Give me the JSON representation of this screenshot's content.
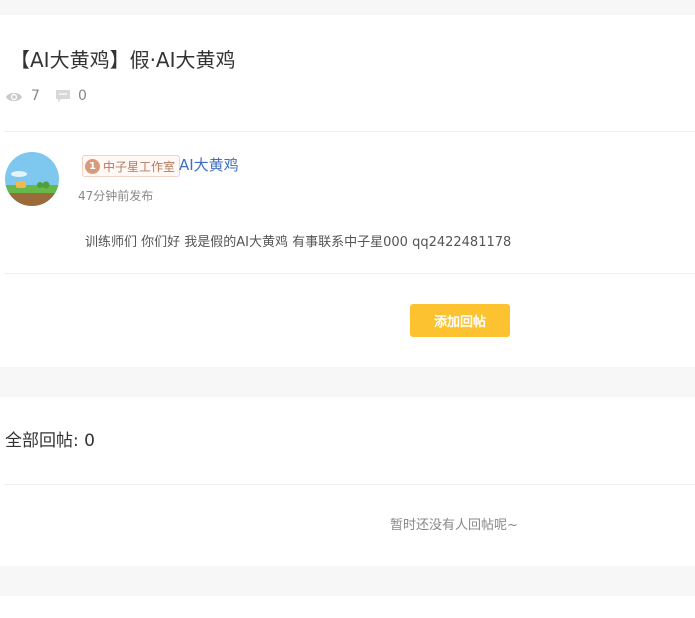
{
  "post": {
    "title": "【AI大黄鸡】假·AI大黄鸡",
    "views": "7",
    "comments": "0",
    "badge_number": "1",
    "badge_text": "中子星工作室",
    "author": "AI大黄鸡",
    "time": "47分钟前发布",
    "content": "训练师们 你们好 我是假的AI大黄鸡 有事联系中子星000 qq2422481178",
    "reply_button": "添加回帖"
  },
  "replies": {
    "heading": "全部回帖: 0",
    "empty_message": "暂时还没有人回帖呢~"
  },
  "colors": {
    "accent_button": "#fcc22f",
    "author_link": "#3f6ec5",
    "page_background": "#f7f7f7"
  },
  "icons": [
    "eye-icon",
    "comment-icon",
    "avatar-image"
  ]
}
